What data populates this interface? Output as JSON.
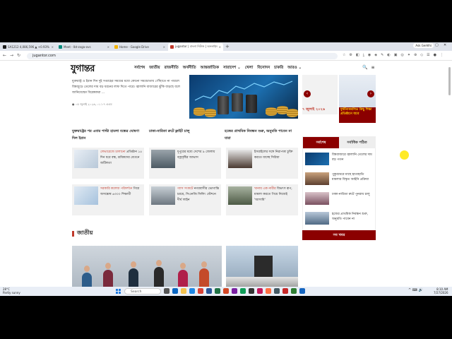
{
  "browser": {
    "tabs": [
      {
        "label": "SA1212 4,086,596 ▲ +0.93%",
        "color": "#1a1a1a"
      },
      {
        "label": "Meet - Ibt-zxga-ovs",
        "color": "#00897b"
      },
      {
        "label": "Home - Google Drive",
        "color": "#f4b400"
      },
      {
        "label": "jugantor | বাংলা নিউজ | অনলাইন",
        "color": "#c0392b"
      }
    ],
    "new_tab": "+",
    "ask_gemini": "Ask Gemini",
    "url": "jugantor.com",
    "back_icon": "←",
    "forward_icon": "→",
    "reload_icon": "↻"
  },
  "site": {
    "logo": "যুগান্তর",
    "nav": [
      "সর্বশেষ",
      "জাতীয়",
      "রাজনীতি",
      "অর্থনীতি",
      "আন্তর্জাতিক",
      "সারাদেশ ⌄",
      "খেলা",
      "বিনোদন",
      "চাকরি",
      "আরও ⌄"
    ],
    "search_icon": "🔍",
    "menu_icon": "≡"
  },
  "hero": {
    "text": "যুক্তরাষ্ট্র ও ইরান দিন দুই সপ্তাহের সময়ের মধ্যে কোনো সমঝোতায় পৌঁছাতে না পারলে বিশ্বজুড়ে তেলের দাম বড় ধরনের লাফ দিতে পারে। জ্বালানি বাজারের ঝুঁকি বাড়ছে বলে জানিয়েছেন বিশ্লেষকরা …",
    "time": "● ০৫ জুলাই ২০২৬, ০১:০৭ এএম"
  },
  "slider": {
    "date": "৭ জুলাই ২০২৬",
    "caption": "দুর্ঘটনাকবলিত কিছু শিক্ষা প্রতিষ্ঠানে যাবে",
    "prev": "‹",
    "next": "›"
  },
  "headlines": [
    "যুক্তরাষ্ট্রের পর এবার পাল্টা হামলা বন্ধের ঘোষণা দিল ইরান",
    "ঢাকা-নারিতা রুটে ফ্লাইট চালু",
    "হজের প্রাথমিক নিবন্ধন শুরু, অনুমতি পাবেন না যারা"
  ],
  "cards": [
    {
      "red": "লেভারেজে চালানো",
      "text": "প্রতিষ্ঠান ১৫ দিন ধরে বন্ধ, শ্রমিকদের বেতনে জটিলতা"
    },
    {
      "red": "",
      "text": "দুপুরের মধ্যে দেশের ৯ জেলায় বজ্রবৃষ্টির আভাস"
    },
    {
      "red": "",
      "text": "ইসরাইলের সঙ্গে নিরাপত্তা চুক্তি করতে যাচ্ছে সিরিয়া"
    },
    {
      "red": "সরকারি কলেজ পরিদর্শনে",
      "text": "গিয়ে অসন্তোষ ৬৩০০ শিক্ষার্থী"
    },
    {
      "red": "গ্যাস সংকটে",
      "text": "নগরবাসীর ভোগান্তি চরমে, সিএনজি ফিলিং স্টেশনে দীর্ঘ লাইন"
    },
    {
      "red": "খানায় এক নারীর",
      "text": "বিভৎস রূপ, মামলা করতে গিয়ে নিজেই 'আসামি'"
    }
  ],
  "sidebar": {
    "tab_latest": "সর্বশেষ",
    "tab_popular": "সর্বাধিক পঠিত",
    "items": [
      "বিশ্ববাজারে জ্বালানি তেলের দাম বড় পতন",
      "পুকুরঘেরে মাছে হাতাহাতি মামলার বিস্তৃত আইনি প্রক্রিয়া",
      "ঢাকা-নারিতা রুটে পুনরায় চালু",
      "হজের প্রাথমিক নিবন্ধন শুরু, অনুমতি পাবেন না"
    ],
    "more": "সব খবর"
  },
  "section": {
    "title": "জাতীয়"
  },
  "taskbar": {
    "weather_temp": "28°C",
    "weather_desc": "Partly sunny",
    "search": "Search",
    "time": "8:10 AM",
    "date": "7/27/2026",
    "tray": "^ ⌨ 🔊"
  }
}
